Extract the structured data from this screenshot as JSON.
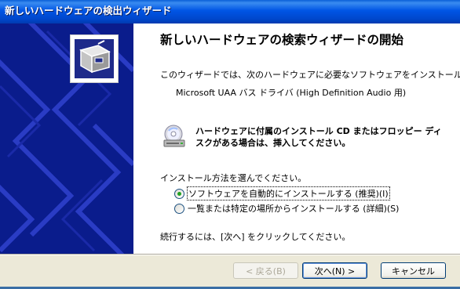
{
  "window": {
    "title": "新しいハードウェアの検出ウィザード"
  },
  "main": {
    "heading": "新しいハードウェアの検索ウィザードの開始",
    "intro": "このウィザードでは、次のハードウェアに必要なソフトウェアをインストールします:",
    "device_name": "Microsoft UAA バス ドライバ (High Definition Audio 用)",
    "cd_prompt": "ハードウェアに付属のインストール CD またはフロッピー ディスクがある場合は、挿入してください。",
    "method_label": "インストール方法を選んでください。",
    "options": [
      {
        "label": "ソフトウェアを自動的にインストールする (推奨)(I)",
        "selected": true
      },
      {
        "label": "一覧または特定の場所からインストールする (詳細)(S)",
        "selected": false
      }
    ],
    "continue_text": "続行するには、[次へ] をクリックしてください。"
  },
  "buttons": {
    "back": "< 戻る(B)",
    "next": "次へ(N) >",
    "cancel": "キャンセル"
  },
  "colors": {
    "titlebar": "#0055e5",
    "left_panel": "#0a1c8c",
    "window_bg": "#ece9d8",
    "radio_selected": "#21a121"
  },
  "icons": {
    "wizard": "hardware-wizard-icon",
    "cd": "cd-drive-icon"
  }
}
